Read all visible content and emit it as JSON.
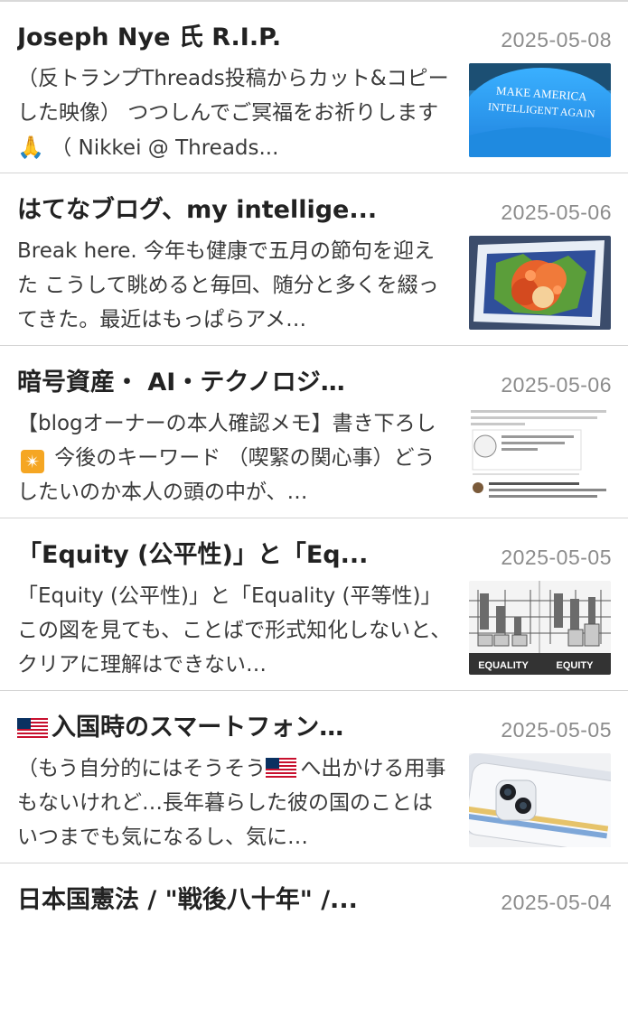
{
  "entries": [
    {
      "title": "Joseph Nye 氏 R.I.P.",
      "date": "2025-05-08",
      "excerpt_before": "（反トランプThreads投稿からカット&コピーした映像） つつしんでご冥福をお祈りします ",
      "emoji": "🙏",
      "excerpt_after": " （ Nikkei @ Threads...",
      "thumb_text_1": "MAKE AMERICA",
      "thumb_text_2": "INTELLIGENT AGAIN",
      "thumb_icon": "blue-cap-photo-icon"
    },
    {
      "title": "はてなブログ、my intellige...",
      "date": "2025-05-06",
      "excerpt": "Break here. 今年も健康で五月の節句を迎えた こうして眺めると毎回、随分と多くを綴ってきた。最近はもっぱらアメ…",
      "thumb_icon": "salmon-roe-dish-photo-icon"
    },
    {
      "title": "暗号資産・ AI・テクノロジ…",
      "date": "2025-05-06",
      "excerpt_before": "【blogオーナーの本人確認メモ】書き下ろし ",
      "emoji": "✴",
      "excerpt_after": " 今後のキーワード （喫緊の関心事）どうしたいのか本人の頭の中が、…",
      "thumb_icon": "tweet-screenshot-icon"
    },
    {
      "title": "「Equity (公平性)」と「Eq...",
      "date": "2025-05-05",
      "excerpt": "「Equity (公平性)」と「Equality (平等性)」 この図を見ても、ことばで形式知化しないと、クリアに理解はできない…",
      "thumb_label_left": "EQUALITY",
      "thumb_label_right": "EQUITY",
      "thumb_icon": "equality-equity-illustration-icon"
    },
    {
      "title": "入国時のスマートフォン…",
      "date": "2025-05-05",
      "excerpt_before": "（もう自分的にはそうそう",
      "excerpt_after": "へ出かける用事もないけれど…長年暮らした彼の国のことはいつまでも気になるし、気に…",
      "flag_icon": "us-flag-icon",
      "thumb_icon": "smartphone-photo-icon"
    },
    {
      "title": "日本国憲法 / \"戦後八十年\" /...",
      "date": "2025-05-04"
    }
  ]
}
